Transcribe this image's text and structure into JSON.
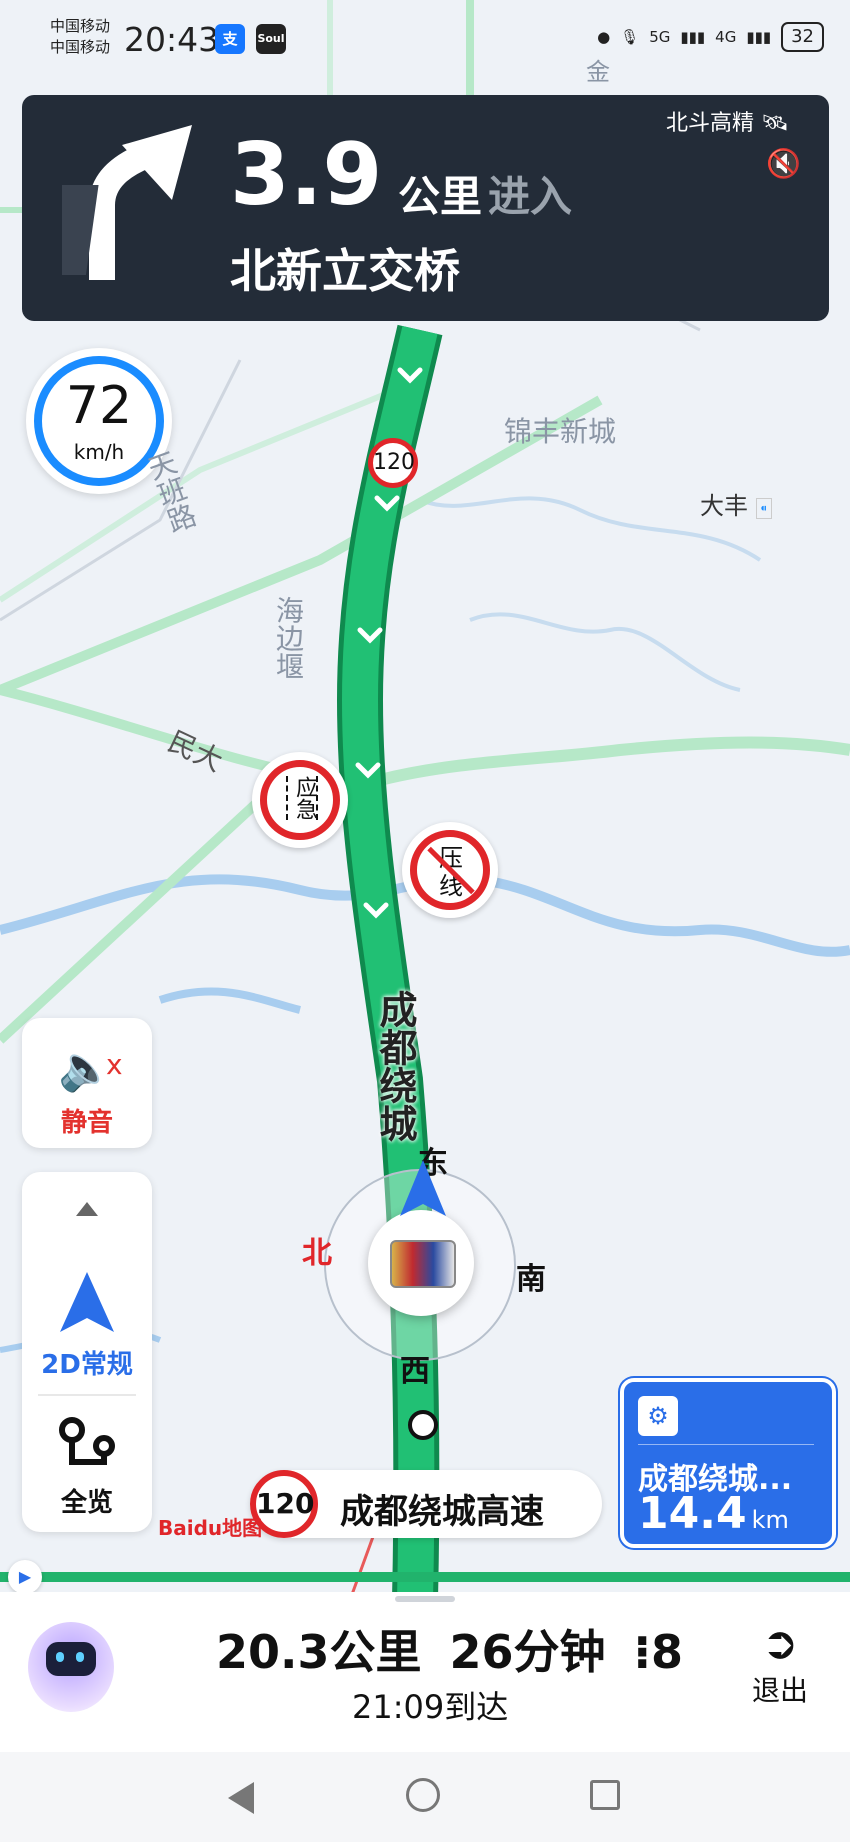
{
  "status_bar": {
    "carrier_1": "中国移动",
    "carrier_2": "中国移动",
    "time": "20:43",
    "app_icon_1": "支",
    "app_icon_2": "Soul",
    "net_1": "5G",
    "net_2": "4G",
    "battery": "32"
  },
  "nav_banner": {
    "distance": "3.9",
    "unit": "公里",
    "action": "进入",
    "road_name": "北新立交桥",
    "gps_label": "北斗高精",
    "turn_icon": "turn-slight-right-icon",
    "sound_icon": "volume-muted-icon"
  },
  "speed": {
    "value": "72",
    "unit": "km/h"
  },
  "map": {
    "labels": {
      "jinfeng": "锦丰新城",
      "dafeng": "大丰",
      "tianban": "天班路",
      "haibian": "海边堰",
      "minda": "民大",
      "highway_name": "成都绕城",
      "jin": "金"
    },
    "speed_limit_sign": "120",
    "sign_emergency": "应急",
    "sign_line": "压线",
    "compass": {
      "north": "北",
      "east": "东",
      "south": "南",
      "west": "西"
    }
  },
  "mute_button": {
    "label": "静音"
  },
  "mode_panel": {
    "mode_label": "2D常规",
    "overview_label": "全览"
  },
  "current_road": {
    "limit": "120",
    "name": "成都绕城高速"
  },
  "next_card": {
    "name": "成都绕城...",
    "distance": "14.4",
    "unit": "km"
  },
  "brand": "Baidu地图",
  "trip": {
    "distance": "20.3公里",
    "duration": "26分钟",
    "lights": "8",
    "arrival": "21:09到达",
    "exit_label": "退出"
  },
  "colors": {
    "route": "#1fb86b",
    "banner": "#232c38",
    "accent": "#2a6ee8",
    "mute": "#e3322e"
  }
}
